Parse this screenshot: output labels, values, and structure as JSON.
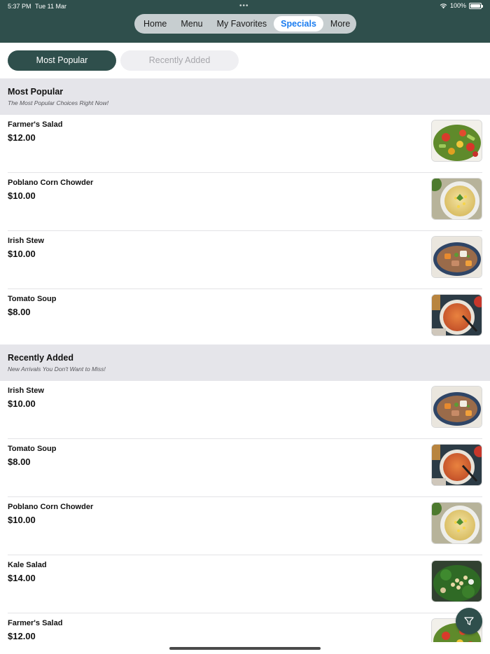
{
  "status_bar": {
    "time": "5:37 PM",
    "date": "Tue 11 Mar",
    "battery": "100%",
    "battery_level": 1.0
  },
  "nav": {
    "items": [
      {
        "label": "Home",
        "active": false
      },
      {
        "label": "Menu",
        "active": false
      },
      {
        "label": "My Favorites",
        "active": false
      },
      {
        "label": "Specials",
        "active": true
      },
      {
        "label": "More",
        "active": false
      }
    ]
  },
  "segments": {
    "most_popular": "Most Popular",
    "recently_added": "Recently Added",
    "selected": "most_popular"
  },
  "sections": [
    {
      "title": "Most Popular",
      "subtitle": "The Most Popular Choices Right Now!",
      "items": [
        {
          "name": "Farmer's Salad",
          "price": "$12.00",
          "image": "salad-photo"
        },
        {
          "name": "Poblano Corn Chowder",
          "price": "$10.00",
          "image": "chowder-photo"
        },
        {
          "name": "Irish Stew",
          "price": "$10.00",
          "image": "stew-photo"
        },
        {
          "name": "Tomato Soup",
          "price": "$8.00",
          "image": "tomato-soup-photo"
        }
      ]
    },
    {
      "title": "Recently Added",
      "subtitle": "New Arrivals You Don't Want to Miss!",
      "items": [
        {
          "name": "Irish Stew",
          "price": "$10.00",
          "image": "stew-photo"
        },
        {
          "name": "Tomato Soup",
          "price": "$8.00",
          "image": "tomato-soup-photo"
        },
        {
          "name": "Poblano Corn Chowder",
          "price": "$10.00",
          "image": "chowder-photo"
        },
        {
          "name": "Kale Salad",
          "price": "$14.00",
          "image": "kale-salad-photo"
        },
        {
          "name": "Farmer's Salad",
          "price": "$12.00",
          "image": "salad-photo"
        }
      ]
    }
  ],
  "colors": {
    "brand": "#2f4f4c",
    "accent": "#1a7cf0",
    "section_bg": "#e5e5ea"
  },
  "icons": {
    "filter": "filter-icon",
    "wifi": "wifi-icon",
    "battery": "battery-icon"
  }
}
